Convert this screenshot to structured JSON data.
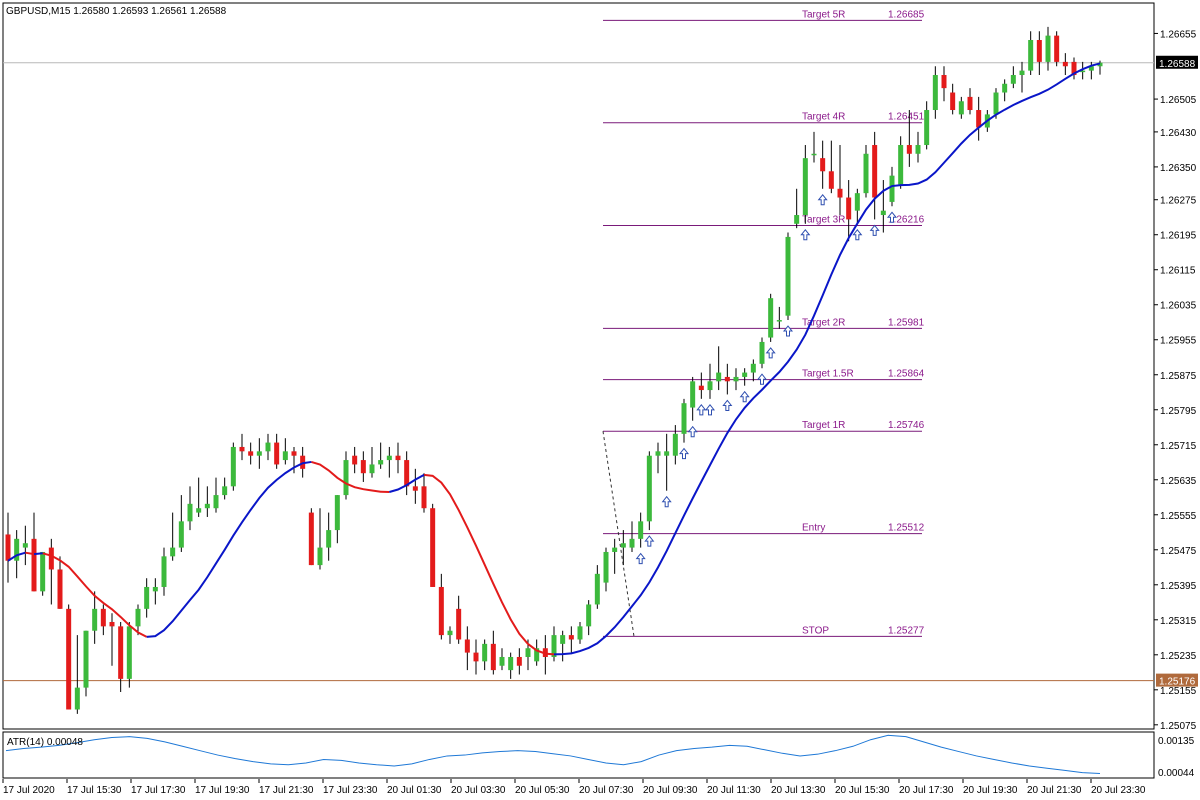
{
  "header": {
    "symbol_label": "GBPUSD,M15  1.26580 1.26593 1.26561 1.26588"
  },
  "price_scale": {
    "labels": [
      "1.26655",
      "1.26505",
      "1.26430",
      "1.26350",
      "1.26275",
      "1.26195",
      "1.26115",
      "1.26035",
      "1.25955",
      "1.25875",
      "1.25795",
      "1.25715",
      "1.25635",
      "1.25555",
      "1.25475",
      "1.25395",
      "1.25315",
      "1.25235",
      "1.25155",
      "1.25075"
    ],
    "current_price": "1.26588",
    "marked_price": "1.25176"
  },
  "levels": [
    {
      "name": "Target 5R",
      "price": "1.26685",
      "value": 1.26685
    },
    {
      "name": "Target 4R",
      "price": "1.26451",
      "value": 1.26451
    },
    {
      "name": "Target 3R",
      "price": "1.26216",
      "value": 1.26216
    },
    {
      "name": "Target 2R",
      "price": "1.25981",
      "value": 1.25981
    },
    {
      "name": "Target 1.5R",
      "price": "1.25864",
      "value": 1.25864
    },
    {
      "name": "Target 1R",
      "price": "1.25746",
      "value": 1.25746
    },
    {
      "name": "Entry",
      "price": "1.25512",
      "value": 1.25512
    },
    {
      "name": "STOP",
      "price": "1.25277",
      "value": 1.25277
    }
  ],
  "time_axis": {
    "labels": [
      "17 Jul 2020",
      "17 Jul 15:30",
      "17 Jul 17:30",
      "17 Jul 19:30",
      "17 Jul 21:30",
      "17 Jul 23:30",
      "20 Jul 01:30",
      "20 Jul 03:30",
      "20 Jul 05:30",
      "20 Jul 07:30",
      "20 Jul 09:30",
      "20 Jul 11:30",
      "20 Jul 13:30",
      "20 Jul 15:30",
      "20 Jul 17:30",
      "20 Jul 19:30",
      "20 Jul 21:30",
      "20 Jul 23:30"
    ]
  },
  "indicator": {
    "label": "ATR(14) 0.00048",
    "scale_labels": [
      "0.00135",
      "0.00044"
    ]
  },
  "colors": {
    "bull": "#3cb93c",
    "bear": "#e31b1b",
    "ma_down": "#e31b1b",
    "ma_up": "#0a16c8",
    "level_line": "#7a1a7a",
    "atr_line": "#1e78d6",
    "arrow": "#2f4fb0",
    "current_price_bg": "#000000",
    "marked_price_bg": "#b06a3c"
  },
  "chart_data": {
    "type": "candlestick",
    "timeframe": "M15",
    "ohlc": [
      [
        1.2551,
        1.2556,
        1.254,
        1.2545
      ],
      [
        1.2545,
        1.2552,
        1.2541,
        1.255
      ],
      [
        1.2548,
        1.2553,
        1.2544,
        1.2549
      ],
      [
        1.255,
        1.2556,
        1.2538,
        1.2538
      ],
      [
        1.2538,
        1.2547,
        1.2537,
        1.2547
      ],
      [
        1.2548,
        1.255,
        1.2535,
        1.2543
      ],
      [
        1.2543,
        1.2546,
        1.2534,
        1.2534
      ],
      [
        1.2534,
        1.2535,
        1.2511,
        1.2511
      ],
      [
        1.2511,
        1.2528,
        1.251,
        1.2516
      ],
      [
        1.2516,
        1.2529,
        1.2514,
        1.2529
      ],
      [
        1.2529,
        1.2538,
        1.2526,
        1.2534
      ],
      [
        1.2534,
        1.2535,
        1.2528,
        1.253
      ],
      [
        1.2531,
        1.2533,
        1.2521,
        1.253
      ],
      [
        1.253,
        1.2531,
        1.2515,
        1.2518
      ],
      [
        1.2518,
        1.2531,
        1.2516,
        1.253
      ],
      [
        1.253,
        1.2535,
        1.2528,
        1.2534
      ],
      [
        1.2534,
        1.2541,
        1.2532,
        1.2539
      ],
      [
        1.2538,
        1.2541,
        1.2535,
        1.2539
      ],
      [
        1.2539,
        1.2548,
        1.2537,
        1.2546
      ],
      [
        1.2546,
        1.2556,
        1.2545,
        1.2548
      ],
      [
        1.2548,
        1.256,
        1.2547,
        1.2554
      ],
      [
        1.2554,
        1.2562,
        1.2552,
        1.2558
      ],
      [
        1.2556,
        1.2564,
        1.2555,
        1.2557
      ],
      [
        1.2557,
        1.2562,
        1.2555,
        1.2558
      ],
      [
        1.2557,
        1.2564,
        1.2556,
        1.256
      ],
      [
        1.256,
        1.2564,
        1.2559,
        1.2562
      ],
      [
        1.2562,
        1.2572,
        1.2561,
        1.2571
      ],
      [
        1.2571,
        1.2574,
        1.2568,
        1.257
      ],
      [
        1.257,
        1.2572,
        1.2567,
        1.2569
      ],
      [
        1.2569,
        1.2573,
        1.2566,
        1.257
      ],
      [
        1.257,
        1.2574,
        1.2568,
        1.2572
      ],
      [
        1.2572,
        1.2574,
        1.2566,
        1.2567
      ],
      [
        1.2568,
        1.2573,
        1.2567,
        1.257
      ],
      [
        1.257,
        1.2571,
        1.2565,
        1.2569
      ],
      [
        1.2569,
        1.2571,
        1.2564,
        1.2566
      ],
      [
        1.2556,
        1.2557,
        1.2544,
        1.2544
      ],
      [
        1.2544,
        1.2557,
        1.2543,
        1.2548
      ],
      [
        1.2548,
        1.2556,
        1.2545,
        1.2552
      ],
      [
        1.2552,
        1.256,
        1.2549,
        1.256
      ],
      [
        1.256,
        1.257,
        1.2559,
        1.2568
      ],
      [
        1.2569,
        1.2571,
        1.2565,
        1.2567
      ],
      [
        1.2568,
        1.257,
        1.2563,
        1.2565
      ],
      [
        1.2565,
        1.2571,
        1.2564,
        1.2567
      ],
      [
        1.2567,
        1.2572,
        1.2566,
        1.2568
      ],
      [
        1.2568,
        1.2571,
        1.2564,
        1.2569
      ],
      [
        1.2569,
        1.2572,
        1.2565,
        1.2568
      ],
      [
        1.2568,
        1.257,
        1.256,
        1.2562
      ],
      [
        1.2562,
        1.2566,
        1.2558,
        1.2561
      ],
      [
        1.2562,
        1.2565,
        1.2556,
        1.2557
      ],
      [
        1.2557,
        1.2558,
        1.2539,
        1.2539
      ],
      [
        1.2539,
        1.2542,
        1.2527,
        1.2528
      ],
      [
        1.2528,
        1.253,
        1.2526,
        1.2529
      ],
      [
        1.2534,
        1.2537,
        1.2526,
        1.2527
      ],
      [
        1.2527,
        1.253,
        1.252,
        1.2524
      ],
      [
        1.2524,
        1.2527,
        1.2519,
        1.2522
      ],
      [
        1.2522,
        1.2527,
        1.252,
        1.2526
      ],
      [
        1.2526,
        1.2529,
        1.2519,
        1.252
      ],
      [
        1.2521,
        1.2525,
        1.252,
        1.2523
      ],
      [
        1.252,
        1.2524,
        1.2518,
        1.2523
      ],
      [
        1.2523,
        1.2525,
        1.2519,
        1.2521
      ],
      [
        1.2523,
        1.2527,
        1.252,
        1.2525
      ],
      [
        1.2522,
        1.2527,
        1.2521,
        1.2525
      ],
      [
        1.2525,
        1.2528,
        1.2519,
        1.2523
      ],
      [
        1.2523,
        1.253,
        1.2522,
        1.2528
      ],
      [
        1.2526,
        1.2529,
        1.2522,
        1.2528
      ],
      [
        1.2528,
        1.253,
        1.2524,
        1.2527
      ],
      [
        1.2527,
        1.2531,
        1.2526,
        1.253
      ],
      [
        1.253,
        1.2536,
        1.2528,
        1.2535
      ],
      [
        1.2535,
        1.2544,
        1.2534,
        1.2542
      ],
      [
        1.254,
        1.2548,
        1.2538,
        1.2547
      ],
      [
        1.2547,
        1.255,
        1.2542,
        1.2548
      ],
      [
        1.2548,
        1.2552,
        1.2544,
        1.2549
      ],
      [
        1.2548,
        1.2554,
        1.2547,
        1.255
      ],
      [
        1.255,
        1.2556,
        1.2548,
        1.2554
      ],
      [
        1.2554,
        1.257,
        1.2552,
        1.2569
      ],
      [
        1.2569,
        1.2572,
        1.2565,
        1.257
      ],
      [
        1.2569,
        1.2574,
        1.2561,
        1.257
      ],
      [
        1.2569,
        1.2576,
        1.2567,
        1.2574
      ],
      [
        1.2574,
        1.2582,
        1.2572,
        1.2581
      ],
      [
        1.258,
        1.2587,
        1.2577,
        1.2586
      ],
      [
        1.2585,
        1.2588,
        1.2582,
        1.2584
      ],
      [
        1.2584,
        1.259,
        1.2582,
        1.2586
      ],
      [
        1.2586,
        1.2594,
        1.2584,
        1.2588
      ],
      [
        1.2587,
        1.259,
        1.2583,
        1.2586
      ],
      [
        1.2586,
        1.2589,
        1.2584,
        1.2587
      ],
      [
        1.2587,
        1.2589,
        1.2585,
        1.2588
      ],
      [
        1.2588,
        1.2591,
        1.2586,
        1.259
      ],
      [
        1.259,
        1.2596,
        1.2589,
        1.2595
      ],
      [
        1.2596,
        1.2606,
        1.2595,
        1.2605
      ],
      [
        1.26,
        1.2603,
        1.2598,
        1.26
      ],
      [
        1.2601,
        1.262,
        1.26,
        1.2619
      ],
      [
        1.2622,
        1.263,
        1.2621,
        1.2624
      ],
      [
        1.2624,
        1.264,
        1.2622,
        1.2637
      ],
      [
        1.2638,
        1.2643,
        1.2636,
        1.2638
      ],
      [
        1.2637,
        1.2641,
        1.263,
        1.2634
      ],
      [
        1.2634,
        1.2641,
        1.2629,
        1.263
      ],
      [
        1.263,
        1.264,
        1.2624,
        1.2628
      ],
      [
        1.2628,
        1.2632,
        1.2618,
        1.2623
      ],
      [
        1.2625,
        1.263,
        1.2622,
        1.2629
      ],
      [
        1.2629,
        1.264,
        1.2628,
        1.2638
      ],
      [
        1.264,
        1.2643,
        1.2623,
        1.2628
      ],
      [
        1.2624,
        1.2632,
        1.262,
        1.2625
      ],
      [
        1.2627,
        1.2635,
        1.2626,
        1.2633
      ],
      [
        1.2631,
        1.2642,
        1.263,
        1.264
      ],
      [
        1.264,
        1.2648,
        1.2635,
        1.2638
      ],
      [
        1.2638,
        1.2643,
        1.2636,
        1.264
      ],
      [
        1.264,
        1.265,
        1.2639,
        1.2648
      ],
      [
        1.2648,
        1.2658,
        1.2646,
        1.2656
      ],
      [
        1.2656,
        1.2658,
        1.265,
        1.2653
      ],
      [
        1.2652,
        1.2654,
        1.2647,
        1.2648
      ],
      [
        1.2647,
        1.2651,
        1.2646,
        1.265
      ],
      [
        1.2651,
        1.2653,
        1.2647,
        1.2648
      ],
      [
        1.2648,
        1.2651,
        1.2641,
        1.2644
      ],
      [
        1.2644,
        1.2648,
        1.2643,
        1.2647
      ],
      [
        1.2647,
        1.2653,
        1.2646,
        1.2652
      ],
      [
        1.2652,
        1.2655,
        1.265,
        1.2654
      ],
      [
        1.2654,
        1.2658,
        1.2653,
        1.2656
      ],
      [
        1.2656,
        1.2659,
        1.2652,
        1.2657
      ],
      [
        1.2657,
        1.2666,
        1.2656,
        1.2664
      ],
      [
        1.2664,
        1.2666,
        1.2656,
        1.2659
      ],
      [
        1.2659,
        1.2667,
        1.2657,
        1.2665
      ],
      [
        1.2665,
        1.2666,
        1.2658,
        1.2659
      ],
      [
        1.2659,
        1.2661,
        1.2656,
        1.2658
      ],
      [
        1.2659,
        1.266,
        1.2655,
        1.2656
      ],
      [
        1.2657,
        1.2659,
        1.2655,
        1.2657
      ],
      [
        1.2657,
        1.2659,
        1.2655,
        1.2658
      ],
      [
        1.2658,
        1.26593,
        1.26561,
        1.26588
      ]
    ],
    "atr": [
      0.001,
      0.00105,
      0.00108,
      0.00112,
      0.00118,
      0.00125,
      0.0013,
      0.00132,
      0.00128,
      0.0012,
      0.0011,
      0.001,
      0.0009,
      0.00082,
      0.00075,
      0.0007,
      0.00068,
      0.00072,
      0.0008,
      0.00078,
      0.00072,
      0.00068,
      0.00065,
      0.0007,
      0.0008,
      0.00088,
      0.0009,
      0.00095,
      0.00098,
      0.001,
      0.00098,
      0.00093,
      0.00088,
      0.0008,
      0.00072,
      0.00068,
      0.00075,
      0.0009,
      0.001,
      0.00105,
      0.00108,
      0.00112,
      0.0011,
      0.00102,
      0.00094,
      0.00088,
      0.00092,
      0.001,
      0.0011,
      0.00125,
      0.00135,
      0.00132,
      0.0012,
      0.00108,
      0.00098,
      0.00088,
      0.0008,
      0.00072,
      0.00065,
      0.0006,
      0.00055,
      0.0005,
      0.00048
    ]
  }
}
